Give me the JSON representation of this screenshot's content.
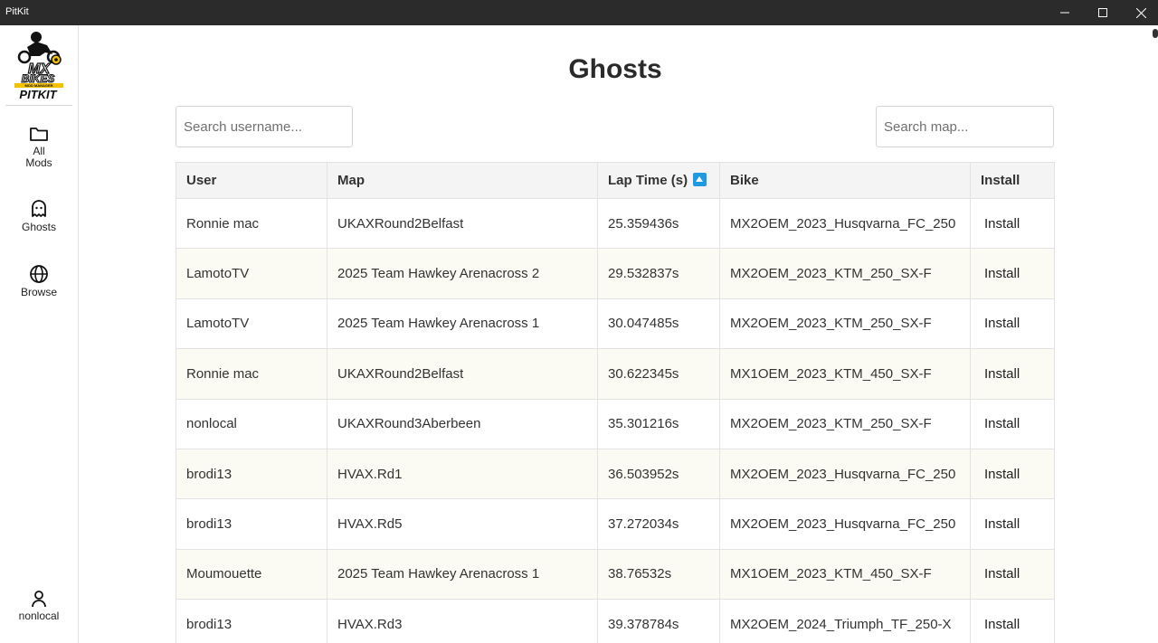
{
  "window": {
    "title": "PitKit"
  },
  "logo": {
    "line1": "MX",
    "line2": "BIKES",
    "line3": "MOD MANAGER",
    "line4": "PITKIT"
  },
  "sidebar": {
    "items": [
      {
        "label": "All\nMods",
        "icon": "folder-icon"
      },
      {
        "label": "Ghosts",
        "icon": "ghost-icon"
      },
      {
        "label": "Browse",
        "icon": "globe-icon"
      }
    ],
    "user": {
      "label": "nonlocal",
      "icon": "user-icon"
    }
  },
  "page": {
    "title": "Ghosts"
  },
  "search": {
    "user_placeholder": "Search username...",
    "map_placeholder": "Search map..."
  },
  "table": {
    "headers": {
      "user": "User",
      "map": "Map",
      "lap": "Lap Time (s)",
      "bike": "Bike",
      "install": "Install"
    },
    "sort": {
      "column": "lap",
      "direction": "ascending",
      "color": "#1e9be0"
    },
    "rows": [
      {
        "user": "Ronnie mac",
        "map": "UKAXRound2Belfast",
        "lap": "25.359436s",
        "bike": "MX2OEM_2023_Husqvarna_FC_250",
        "install": "Install"
      },
      {
        "user": "LamotoTV",
        "map": "2025 Team Hawkey Arenacross 2",
        "lap": "29.532837s",
        "bike": "MX2OEM_2023_KTM_250_SX-F",
        "install": "Install"
      },
      {
        "user": "LamotoTV",
        "map": "2025 Team Hawkey Arenacross 1",
        "lap": "30.047485s",
        "bike": "MX2OEM_2023_KTM_250_SX-F",
        "install": "Install"
      },
      {
        "user": "Ronnie mac",
        "map": "UKAXRound2Belfast",
        "lap": "30.622345s",
        "bike": "MX1OEM_2023_KTM_450_SX-F",
        "install": "Install"
      },
      {
        "user": "nonlocal",
        "map": "UKAXRound3Aberbeen",
        "lap": "35.301216s",
        "bike": "MX2OEM_2023_KTM_250_SX-F",
        "install": "Install"
      },
      {
        "user": "brodi13",
        "map": "HVAX.Rd1",
        "lap": "36.503952s",
        "bike": "MX2OEM_2023_Husqvarna_FC_250",
        "install": "Install"
      },
      {
        "user": "brodi13",
        "map": "HVAX.Rd5",
        "lap": "37.272034s",
        "bike": "MX2OEM_2023_Husqvarna_FC_250",
        "install": "Install"
      },
      {
        "user": "Moumouette",
        "map": "2025 Team Hawkey Arenacross 1",
        "lap": "38.76532s",
        "bike": "MX1OEM_2023_KTM_450_SX-F",
        "install": "Install"
      },
      {
        "user": "brodi13",
        "map": "HVAX.Rd3",
        "lap": "39.378784s",
        "bike": "MX2OEM_2024_Triumph_TF_250-X",
        "install": "Install"
      }
    ]
  }
}
